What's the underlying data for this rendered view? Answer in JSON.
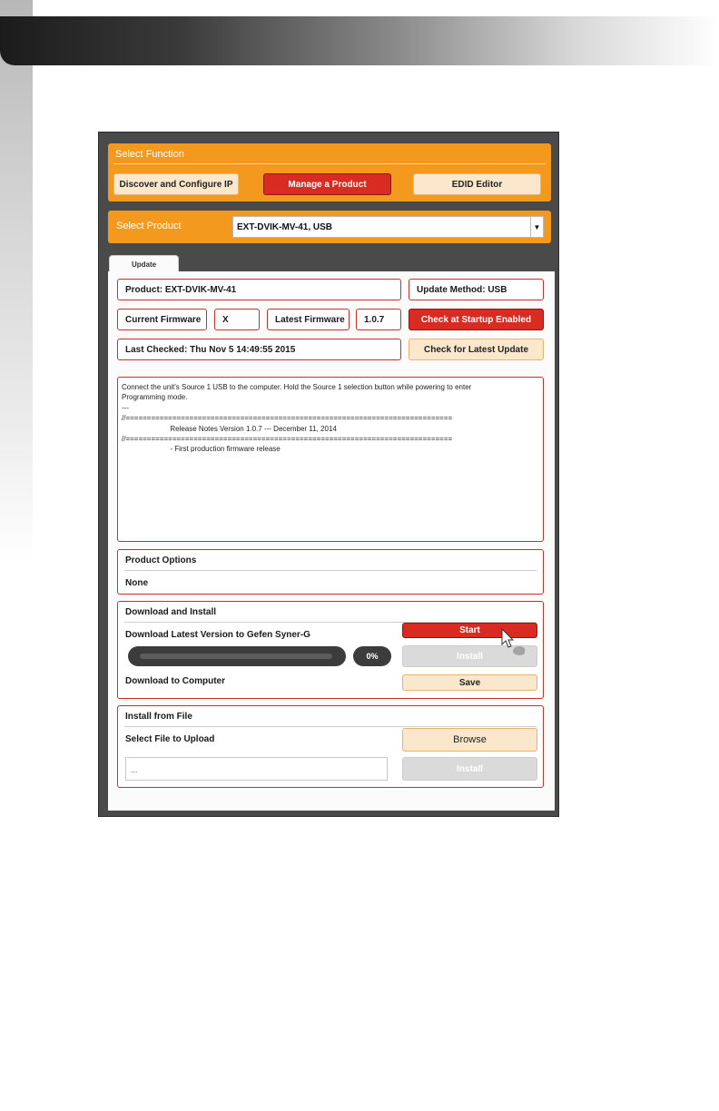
{
  "select_function": {
    "title": "Select Function",
    "buttons": [
      "Discover and Configure IP",
      "Manage a Product",
      "EDID Editor"
    ]
  },
  "select_product": {
    "label": "Select Product",
    "value": "EXT-DVIK-MV-41, USB"
  },
  "tab": {
    "label": "Update"
  },
  "info": {
    "product": "Product: EXT-DVIK-MV-41",
    "update_method": "Update Method: USB",
    "current_fw_label": "Current Firmware",
    "current_fw_value": "X",
    "latest_fw_label": "Latest Firmware",
    "latest_fw_value": "1.0.7",
    "check_startup": "Check at Startup Enabled",
    "last_checked": "Last Checked: Thu Nov 5 14:49:55 2015",
    "check_latest": "Check for Latest Update"
  },
  "notes": {
    "lines": [
      "Connect the unit's Source 1 USB to the computer. Hold the Source 1 selection button while powering to enter",
      "Programming mode.",
      "---",
      "//=============================================================================",
      "                        Release Notes Version 1.0.7 --- December 11, 2014",
      "//=============================================================================",
      "",
      "                        - First production firmware release"
    ]
  },
  "product_options": {
    "title": "Product Options",
    "value": "None"
  },
  "download_install": {
    "title": "Download and Install",
    "latest_label": "Download Latest Version to Gefen Syner-G",
    "start": "Start",
    "install": "Install",
    "progress_percent": 0,
    "progress_text": "0%",
    "computer_label": "Download to Computer",
    "save": "Save"
  },
  "install_file": {
    "title": "Install from File",
    "select_label": "Select File to Upload",
    "browse": "Browse",
    "file_value": "...",
    "install": "Install"
  },
  "colors": {
    "orange": "#f39a1e",
    "red": "#d92b21",
    "cream": "#fbe8cc",
    "disabled": "#dadada"
  }
}
